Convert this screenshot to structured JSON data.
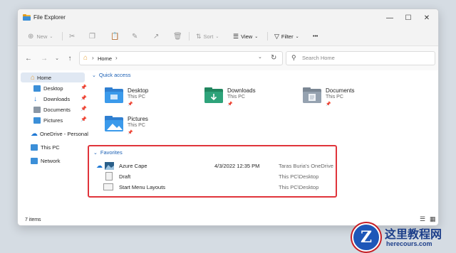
{
  "window": {
    "title": "File Explorer"
  },
  "toolbar": {
    "new_label": "New",
    "sort_label": "Sort",
    "view_label": "View",
    "filter_label": "Filter",
    "more_label": "•••"
  },
  "address": {
    "home_label": "Home",
    "separator": "›"
  },
  "search": {
    "placeholder": "Search Home"
  },
  "sidebar": {
    "items": [
      {
        "label": "Home",
        "icon": "home-icon",
        "color": "#e8a23a"
      },
      {
        "label": "Desktop",
        "icon": "desktop-icon",
        "color": "#3b8fd8"
      },
      {
        "label": "Downloads",
        "icon": "downloads-icon",
        "color": "#2b7ad0"
      },
      {
        "label": "Documents",
        "icon": "documents-icon",
        "color": "#8b97a5"
      },
      {
        "label": "Pictures",
        "icon": "pictures-icon",
        "color": "#3b8fd8"
      },
      {
        "label": "OneDrive - Personal",
        "icon": "onedrive-icon",
        "color": "#1e78d4"
      },
      {
        "label": "This PC",
        "icon": "this-pc-icon",
        "color": "#3b8fd8"
      },
      {
        "label": "Network",
        "icon": "network-icon",
        "color": "#3b8fd8"
      }
    ]
  },
  "quick_access": {
    "title": "Quick access",
    "tiles": [
      {
        "name": "Desktop",
        "location": "This PC"
      },
      {
        "name": "Downloads",
        "location": "This PC"
      },
      {
        "name": "Documents",
        "location": "This PC"
      },
      {
        "name": "Pictures",
        "location": "This PC"
      }
    ]
  },
  "favorites": {
    "title": "Favorites",
    "rows": [
      {
        "name": "Azure Cape",
        "date": "4/3/2022 12:35 PM",
        "location": "Taras Buria's OneDrive"
      },
      {
        "name": "Draft",
        "date": "",
        "location": "This PC\\Desktop"
      },
      {
        "name": "Start Menu Layouts",
        "date": "",
        "location": "This PC\\Desktop"
      }
    ]
  },
  "status": {
    "items_count": "7 items"
  },
  "watermark": {
    "title": "这里教程网",
    "url": "herecours.com",
    "letter": "Z"
  },
  "colors": {
    "accent": "#1a5fb4",
    "highlight_border": "#e0343b",
    "folder_blue": "#3b8fd8",
    "folder_green": "#2ea37a"
  }
}
